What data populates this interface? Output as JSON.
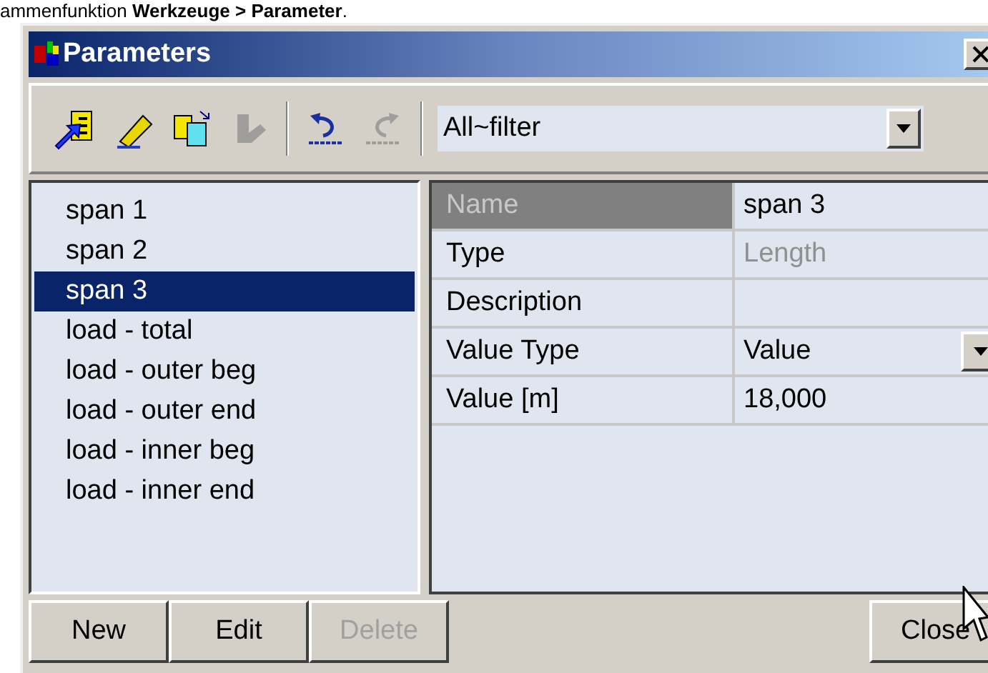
{
  "caption": "ammenfunktion **Werkzeuge > Parameter**.",
  "window": {
    "title": "Parameters"
  },
  "toolbar": {
    "tools": [
      {
        "kind": "insert",
        "disabled": false
      },
      {
        "kind": "edit",
        "disabled": false
      },
      {
        "kind": "copy",
        "disabled": false
      },
      {
        "kind": "mark",
        "disabled": true
      },
      {
        "kind": "undo",
        "disabled": false
      },
      {
        "kind": "redo",
        "disabled": true
      }
    ],
    "filter": {
      "value": "All~filter"
    }
  },
  "parameters": [
    {
      "label": "span 1",
      "selected": false
    },
    {
      "label": "span 2",
      "selected": false
    },
    {
      "label": "span 3",
      "selected": true
    },
    {
      "label": "load - total",
      "selected": false
    },
    {
      "label": "load - outer beg",
      "selected": false
    },
    {
      "label": "load - outer end",
      "selected": false
    },
    {
      "label": "load - inner beg",
      "selected": false
    },
    {
      "label": "load - inner end",
      "selected": false
    }
  ],
  "properties": [
    {
      "label": "Name",
      "value": "span 3",
      "selected": true,
      "kind": "text"
    },
    {
      "label": "Type",
      "value": "Length",
      "selected": false,
      "kind": "readonly"
    },
    {
      "label": "Description",
      "selected": false,
      "kind": "text"
    },
    {
      "label": "Value Type",
      "value": "Value",
      "selected": false,
      "kind": "dropdown"
    },
    {
      "label": "Value [m]",
      "value": "18,000",
      "selected": false,
      "kind": "text"
    }
  ],
  "buttons": [
    {
      "label": "New",
      "disabled": false
    },
    {
      "label": "Edit",
      "disabled": false
    },
    {
      "label": "Delete",
      "disabled": true
    }
  ],
  "close_button": {
    "label": "Close"
  }
}
